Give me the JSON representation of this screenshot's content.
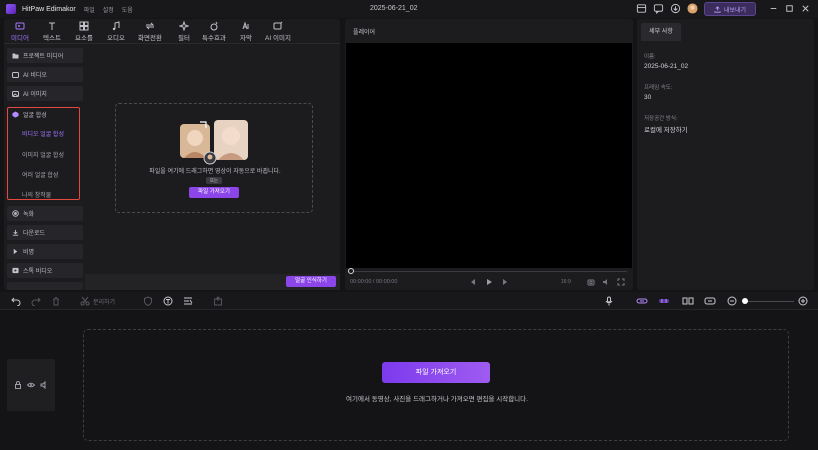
{
  "app": {
    "name": "HitPaw Edimakor",
    "menus": [
      "파일",
      "설정",
      "도움"
    ],
    "document_title": "2025-06-21_02",
    "export_label": "내보내기",
    "accent": "#8b45e8"
  },
  "toolbar": {
    "tools": [
      {
        "label": "미디어",
        "icon": "media-icon"
      },
      {
        "label": "텍스트",
        "icon": "text-icon"
      },
      {
        "label": "요소를",
        "icon": "elements-icon"
      },
      {
        "label": "오디오",
        "icon": "audio-icon"
      },
      {
        "label": "화면전환",
        "icon": "transition-icon"
      },
      {
        "label": "필터",
        "icon": "filter-icon"
      },
      {
        "label": "특수효과",
        "icon": "effects-icon"
      },
      {
        "label": "자막",
        "icon": "subtitle-icon"
      },
      {
        "label": "AI 이미지",
        "icon": "ai-image-icon"
      }
    ]
  },
  "sidebar": {
    "items": [
      {
        "label": "프로젝트 미디어"
      },
      {
        "label": "AI 비디오"
      },
      {
        "label": "AI 이미지"
      },
      {
        "label": "얼굴 합성"
      },
      {
        "label": "녹화"
      },
      {
        "label": "다운로드"
      },
      {
        "label": "비명"
      },
      {
        "label": "스톡 비디오"
      }
    ],
    "sub_items": [
      {
        "label": "비디오 얼굴 합성"
      },
      {
        "label": "이미지 얼굴 합성"
      },
      {
        "label": "여러 얼굴 합성"
      },
      {
        "label": "나의 창작물"
      }
    ]
  },
  "media_area": {
    "hint": "파일을 여기에 드래그하면 영상이 자동으로 바뀝니다.",
    "chip": "또는",
    "import_label": "파일 가져오기",
    "face_swap_label": "얼굴 인식하기"
  },
  "player": {
    "title": "플레이어",
    "timecode": "00:00:00 / 00:00:00",
    "ratio": "16:9"
  },
  "details": {
    "tab": "세부 사항",
    "fields": [
      {
        "label": "이름:",
        "value": "2025-06-21_02"
      },
      {
        "label": "프레임 속도:",
        "value": "30"
      },
      {
        "label": "저장공간 방식:",
        "value": "로컬에 저장하기"
      }
    ]
  },
  "timeline_toolbar": {
    "split_label": "분리하기"
  },
  "timeline": {
    "import_label": "파일 가져오기",
    "hint": "여기에서 동영상, 사진을 드래그하거나 가져오면 편집을 시작합니다."
  }
}
